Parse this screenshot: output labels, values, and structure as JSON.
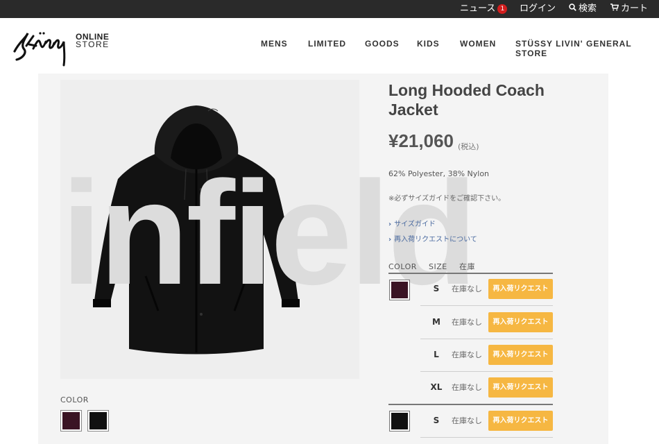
{
  "topbar": {
    "news": "ニュース",
    "news_count": "1",
    "login": "ログイン",
    "search": "検索",
    "cart": "カート"
  },
  "brand": {
    "line1": "ONLINE",
    "line2": "STORE"
  },
  "nav": [
    "MENS",
    "LIMITED",
    "GOODS",
    "KIDS",
    "WOMEN",
    "STÜSSY LIVIN' GENERAL STORE"
  ],
  "watermark": "infield",
  "product": {
    "title": "Long Hooded Coach Jacket",
    "price": "¥21,060",
    "tax": "(税込)",
    "material": "62% Polyester, 38% Nylon",
    "note": "※必ずサイズガイドをご確認下さい。",
    "links": [
      "サイズガイド",
      "再入荷リクエストについて"
    ]
  },
  "gallery": {
    "color_label": "COLOR",
    "swatches": [
      {
        "name": "burgundy",
        "color": "#3a1424"
      },
      {
        "name": "black",
        "color": "#111111"
      }
    ]
  },
  "stock_table": {
    "headers": [
      "COLOR",
      "SIZE",
      "在庫"
    ],
    "rows": [
      {
        "swatch": "#3a1424",
        "size": "S",
        "stock": "在庫なし",
        "button": "再入荷リクエスト"
      },
      {
        "swatch": "",
        "size": "M",
        "stock": "在庫なし",
        "button": "再入荷リクエスト"
      },
      {
        "swatch": "",
        "size": "L",
        "stock": "在庫なし",
        "button": "再入荷リクエスト"
      },
      {
        "swatch": "",
        "size": "XL",
        "stock": "在庫なし",
        "button": "再入荷リクエスト"
      },
      {
        "swatch": "#111111",
        "size": "S",
        "stock": "在庫なし",
        "button": "再入荷リクエスト"
      }
    ]
  },
  "colors": {
    "topbar_bg": "#2a2a2a",
    "badge": "#d21d1d",
    "request_button": "#f6b742"
  }
}
